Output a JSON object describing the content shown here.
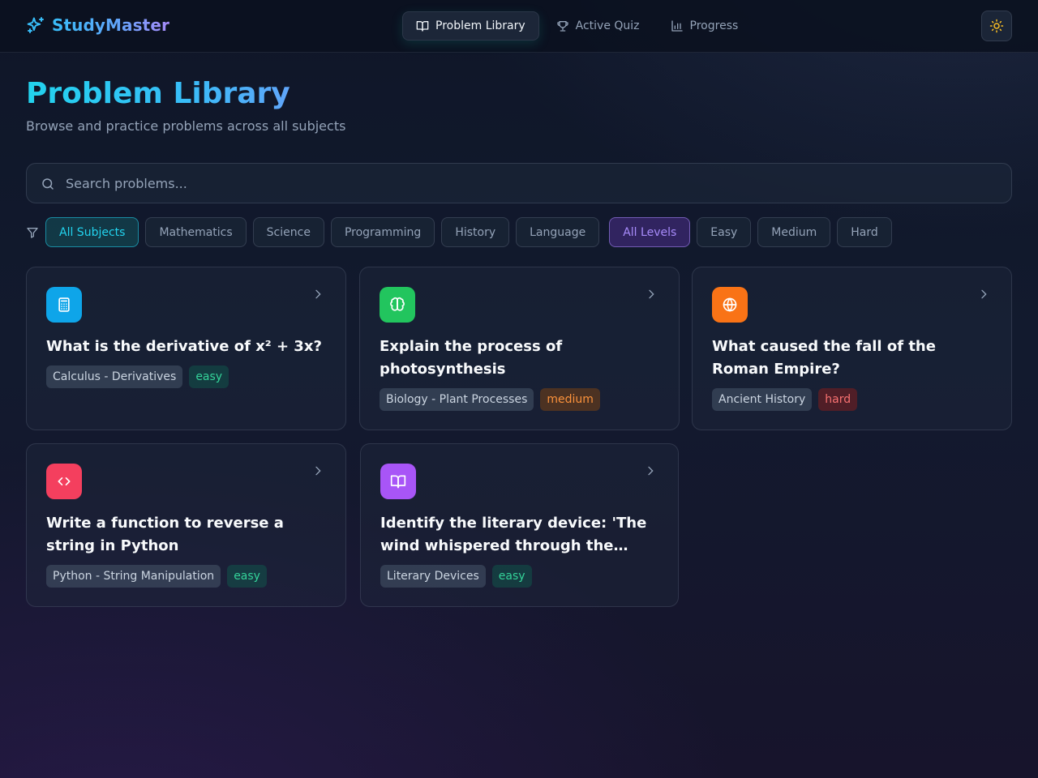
{
  "nav": {
    "brand": "StudyMaster",
    "tabs": [
      {
        "label": "Problem Library",
        "icon": "book-open-icon",
        "active": true
      },
      {
        "label": "Active Quiz",
        "icon": "trophy-icon",
        "active": false
      },
      {
        "label": "Progress",
        "icon": "bar-chart-icon",
        "active": false
      }
    ],
    "theme_icon": "sun-icon"
  },
  "header": {
    "title": "Problem Library",
    "subtitle": "Browse and practice problems across all subjects"
  },
  "search": {
    "placeholder": "Search problems...",
    "value": ""
  },
  "filters": {
    "subjects": [
      "All Subjects",
      "Mathematics",
      "Science",
      "Programming",
      "History",
      "Language"
    ],
    "selected_subject": "All Subjects",
    "levels": [
      "All Levels",
      "Easy",
      "Medium",
      "Hard"
    ],
    "selected_level": "All Levels"
  },
  "problems": [
    {
      "icon": "calculator-icon",
      "icon_color": "#0ea5e9",
      "title": "What is the derivative of x² + 3x?",
      "topic": "Calculus - Derivatives",
      "difficulty": "easy"
    },
    {
      "icon": "brain-icon",
      "icon_color": "#22c55e",
      "title": "Explain the process of photosynthesis",
      "topic": "Biology - Plant Processes",
      "difficulty": "medium"
    },
    {
      "icon": "globe-icon",
      "icon_color": "#f97316",
      "title": "What caused the fall of the Roman Empire?",
      "topic": "Ancient History",
      "difficulty": "hard"
    },
    {
      "icon": "code-icon",
      "icon_color": "#f43f5e",
      "title": "Write a function to reverse a string in Python",
      "topic": "Python - String Manipulation",
      "difficulty": "easy"
    },
    {
      "icon": "book-open-icon",
      "icon_color": "#a855f7",
      "title": "Identify the literary device: 'The wind whispered through the…",
      "topic": "Literary Devices",
      "difficulty": "easy"
    }
  ],
  "colors": {
    "accent_cyan": "#22d3ee",
    "accent_violet": "#a78bfa",
    "easy": "#34d399",
    "medium": "#fb923c",
    "hard": "#f87171"
  }
}
